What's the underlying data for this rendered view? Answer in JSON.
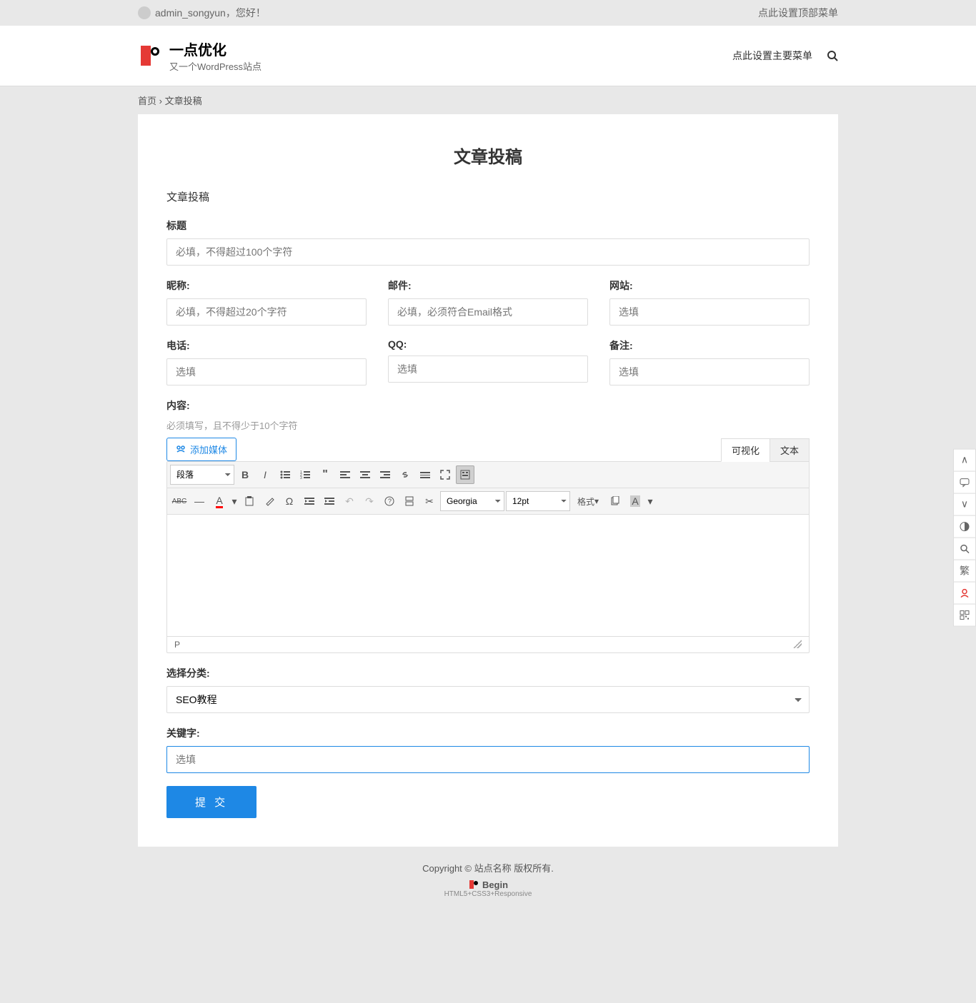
{
  "topbar": {
    "user": "admin_songyun",
    "greeting": "，您好！",
    "menu_setup": "点此设置顶部菜单"
  },
  "header": {
    "title": "一点优化",
    "subtitle": "又一个WordPress站点",
    "nav_setup": "点此设置主要菜单"
  },
  "breadcrumb": {
    "home": "首页",
    "sep": "›",
    "current": "文章投稿"
  },
  "page": {
    "title": "文章投稿",
    "section": "文章投稿"
  },
  "form": {
    "title_label": "标题",
    "title_placeholder": "必填，不得超过100个字符",
    "nickname_label": "昵称:",
    "nickname_placeholder": "必填，不得超过20个字符",
    "email_label": "邮件:",
    "email_placeholder": "必填，必须符合Email格式",
    "website_label": "网站:",
    "website_placeholder": "选填",
    "phone_label": "电话:",
    "phone_placeholder": "选填",
    "qq_label": "QQ:",
    "qq_placeholder": "选填",
    "remark_label": "备注:",
    "remark_placeholder": "选填",
    "content_label": "内容:",
    "content_hint": "必须填写，且不得少于10个字符",
    "media_btn": "添加媒体",
    "tab_visual": "可视化",
    "tab_text": "文本",
    "format_select": "段落",
    "font_select": "Georgia",
    "size_select": "12pt",
    "style_select": "格式",
    "status_path": "P",
    "category_label": "选择分类:",
    "category_value": "SEO教程",
    "keyword_label": "关键字:",
    "keyword_placeholder": "选填",
    "submit": "提 交"
  },
  "footer": {
    "copyright": "Copyright ©   站点名称  版权所有.",
    "brand": "Begin",
    "brand_sub": "HTML5+CSS3+Responsive"
  },
  "side": {
    "simplified": "繁"
  }
}
